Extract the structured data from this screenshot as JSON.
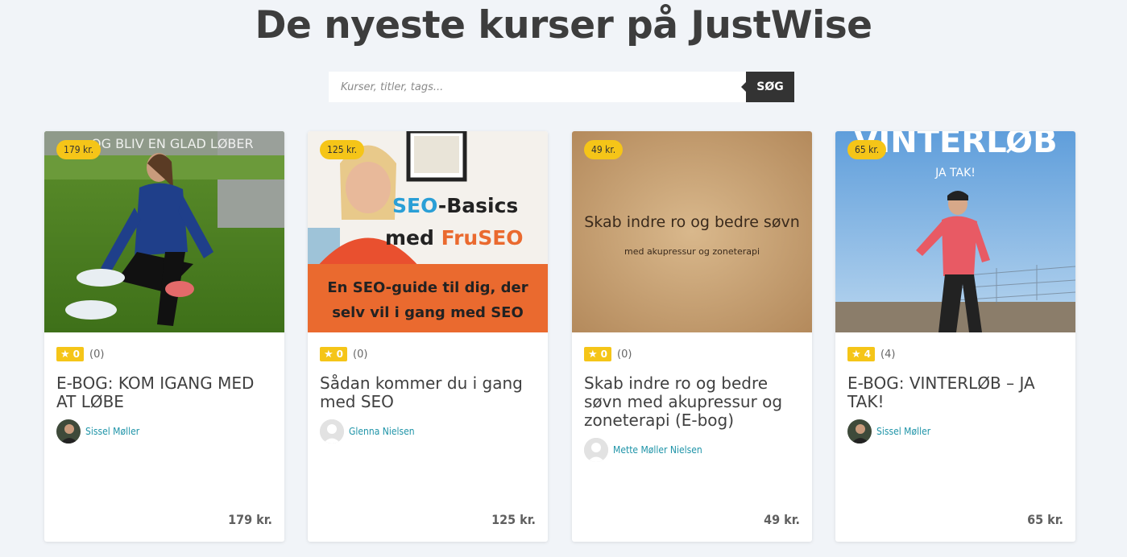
{
  "page": {
    "title": "De nyeste kurser på JustWise"
  },
  "search": {
    "placeholder": "Kurser, titler, tags...",
    "button_label": "SØG"
  },
  "courses": [
    {
      "price_tag": "179 kr.",
      "image_text": "OG BLIV EN GLAD LØBER",
      "rating": "0",
      "rating_count": "(0)",
      "title": "E-BOG: KOM IGANG MED AT LØBE",
      "author": "Sissel Møller",
      "price": "179 kr."
    },
    {
      "price_tag": "125 kr.",
      "image_text": {
        "line1_a": "SEO",
        "line1_b": "-Basics",
        "line2_a": "med ",
        "line2_b": "FruSEO",
        "banner1": "En SEO-guide til dig, der",
        "banner2": "selv vil i gang med SEO"
      },
      "rating": "0",
      "rating_count": "(0)",
      "title": "Sådan kommer du i gang med SEO",
      "author": "Glenna Nielsen",
      "price": "125 kr."
    },
    {
      "price_tag": "49 kr.",
      "image_text": {
        "headline": "Skab indre ro og bedre søvn",
        "sub": "med akupressur og zoneterapi"
      },
      "rating": "0",
      "rating_count": "(0)",
      "title": "Skab indre ro og bedre søvn med akupressur og zoneterapi (E-bog)",
      "author": "Mette Møller Nielsen",
      "price": "49 kr."
    },
    {
      "price_tag": "65 kr.",
      "image_text": {
        "headline": "VINTERLØB",
        "sub": "JA TAK!"
      },
      "rating": "4",
      "rating_count": "(4)",
      "title": "E-BOG: VINTERLØB – JA TAK!",
      "author": "Sissel Møller",
      "price": "65 kr."
    }
  ],
  "colors": {
    "background": "#f1f4f8",
    "accent_yellow": "#f5c518",
    "author_link": "#1f94a8",
    "search_button": "#333333",
    "seo_orange": "#ea6a2f",
    "seo_blue": "#2a9fd6"
  }
}
